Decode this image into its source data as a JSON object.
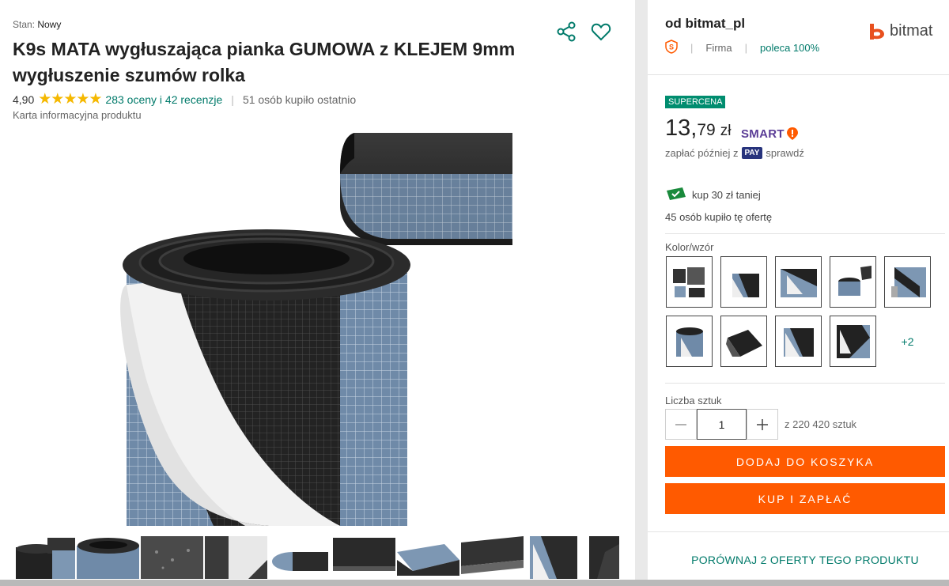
{
  "product": {
    "condition_label": "Stan:",
    "condition_value": "Nowy",
    "title": "K9s MATA wygłuszająca pianka GUMOWA z KLEJEM 9mm wygłuszenie szumów rolka",
    "rating": "4,90",
    "stars": 5,
    "reviews_link": "283 oceny i 42 recenzje",
    "bought_recently": "51 osób kupiło ostatnio",
    "info_card": "Karta informacyjna produktu",
    "thumbnail_count": 10
  },
  "seller": {
    "name": "od bitmat_pl",
    "type": "Firma",
    "recommend": "poleca 100%",
    "logo_text": "bitmat"
  },
  "offer": {
    "badge": "SUPERCENA",
    "price_int": "13,",
    "price_cents": "79",
    "currency": "zł",
    "smart": "SMART",
    "pay_later_prefix": "zapłać później z",
    "pay_badge": "PAY",
    "pay_later_suffix": "sprawdź",
    "cheaper": "kup 30 zł taniej",
    "bought": "45 osób kupiło tę ofertę"
  },
  "variants": {
    "label": "Kolor/wzór",
    "more": "+2"
  },
  "quantity": {
    "label": "Liczba sztuk",
    "value": "1",
    "available": "z 220 420 sztuk"
  },
  "actions": {
    "add_to_cart": "DODAJ DO KOSZYKA",
    "buy_now": "KUP I ZAPŁAĆ",
    "compare": "PORÓWNAJ 2 OFERTY TEGO PRODUKTU"
  },
  "colors": {
    "accent_orange": "#ff5a00",
    "accent_green": "#007a6a",
    "badge_green": "#008d6f",
    "star": "#f5b800",
    "smart_purple": "#5a3c96",
    "pay_blue": "#27337c"
  }
}
